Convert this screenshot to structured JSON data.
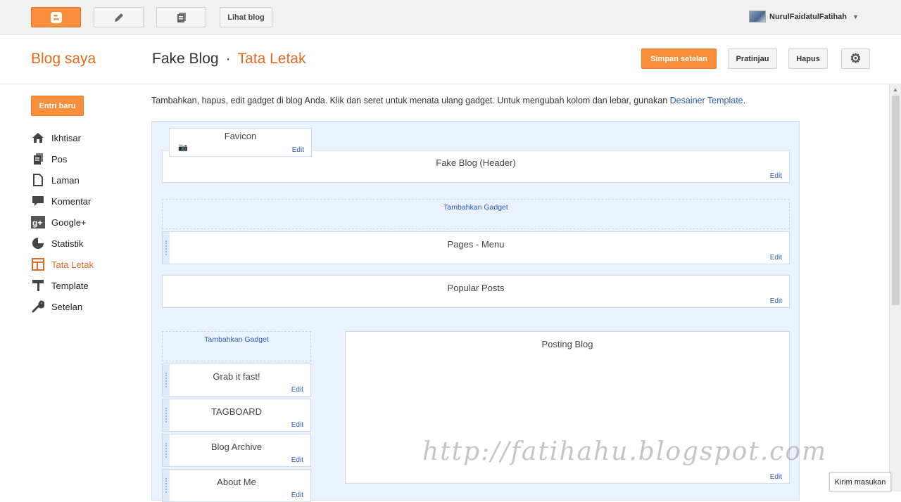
{
  "topbar": {
    "view_blog": "Lihat blog",
    "username": "NurulFaidatulFatihah"
  },
  "header": {
    "my_blogs": "Blog saya",
    "blog_name": "Fake Blog",
    "separator": "·",
    "page_name": "Tata Letak",
    "save": "Simpan setelan",
    "preview": "Pratinjau",
    "delete": "Hapus"
  },
  "sidebar": {
    "new_post": "Entri baru",
    "items": [
      {
        "label": "Ikhtisar",
        "icon": "home-icon"
      },
      {
        "label": "Pos",
        "icon": "posts-icon"
      },
      {
        "label": "Laman",
        "icon": "pages-icon"
      },
      {
        "label": "Komentar",
        "icon": "comment-icon"
      },
      {
        "label": "Google+",
        "icon": "google-plus-icon"
      },
      {
        "label": "Statistik",
        "icon": "stats-icon"
      },
      {
        "label": "Tata Letak",
        "icon": "layout-icon",
        "active": true
      },
      {
        "label": "Template",
        "icon": "template-icon"
      },
      {
        "label": "Setelan",
        "icon": "wrench-icon"
      }
    ]
  },
  "intro": {
    "text": "Tambahkan, hapus, edit gadget di blog Anda. Klik dan seret untuk menata ulang gadget. Untuk mengubah kolom dan lebar, gunakan ",
    "link": "Desainer Template",
    "end": "."
  },
  "layout": {
    "edit": "Edit",
    "add_gadget": "Tambahkan Gadget",
    "favicon": "Favicon",
    "header": "Fake Blog (Header)",
    "pages_menu": "Pages - Menu",
    "popular_posts": "Popular Posts",
    "blog_posts": "Posting Blog",
    "sidebar_gadgets": [
      "Grab it fast!",
      "TAGBOARD",
      "Blog Archive",
      "About Me"
    ]
  },
  "watermark": "http://fatihahu.blogspot.com",
  "feedback": "Kirim masukan",
  "colors": {
    "accent": "#fa8f3b",
    "link": "#2a5db0",
    "layout_bg": "#eaf2fd"
  }
}
